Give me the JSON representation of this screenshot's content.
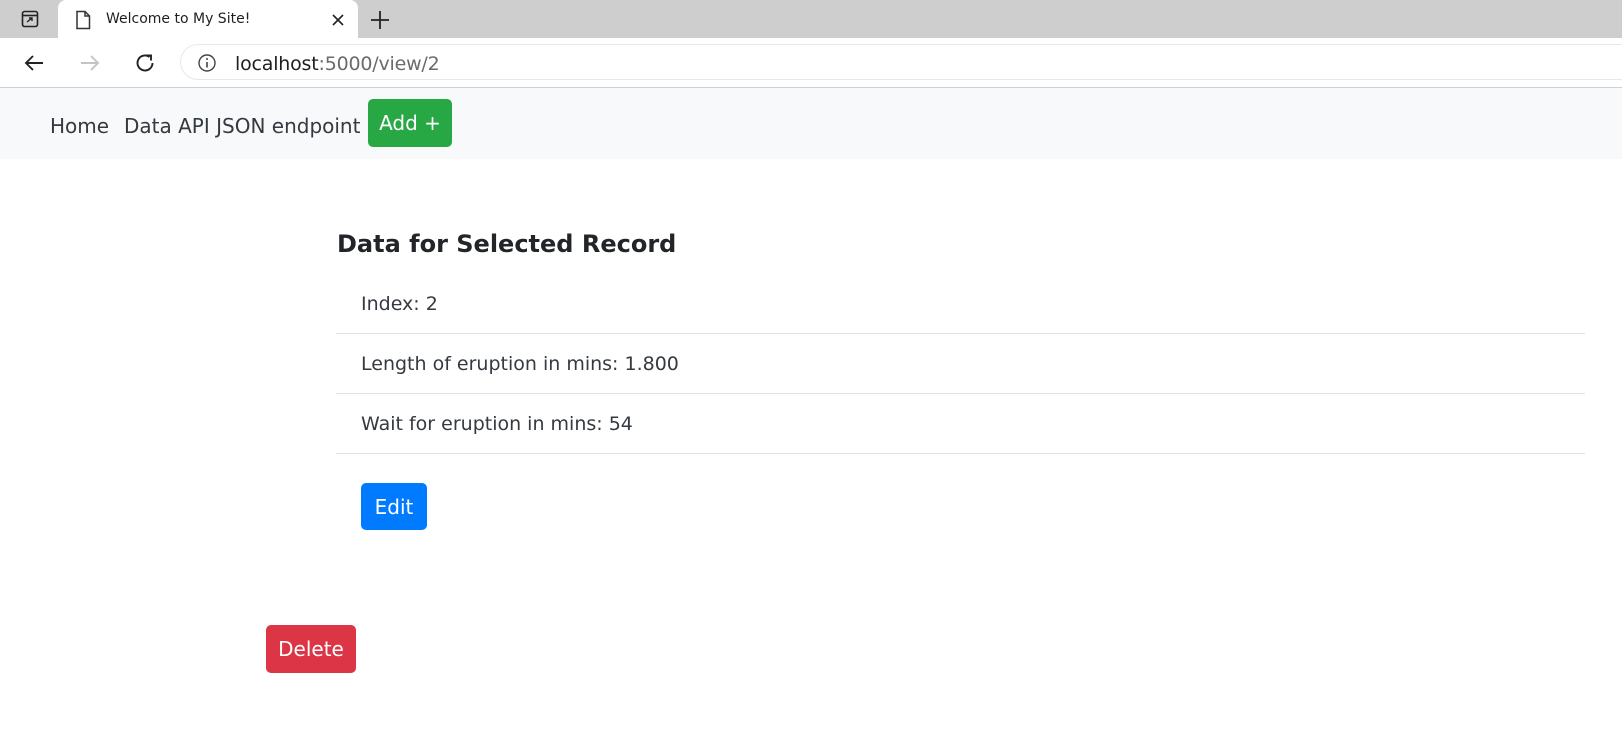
{
  "browser": {
    "tab_title": "Welcome to My Site!",
    "url_host": "localhost",
    "url_path": ":5000/view/2"
  },
  "icons": {
    "tab_actions": "tab-actions-icon",
    "page": "page-icon",
    "close": "close-icon",
    "new_tab": "plus-icon",
    "back": "back-arrow-icon",
    "forward": "forward-arrow-icon",
    "reload": "reload-icon",
    "site_info": "info-icon"
  },
  "nav": {
    "home": "Home",
    "api": "Data API JSON endpoint",
    "add": "Add +"
  },
  "record": {
    "heading": "Data for Selected Record",
    "items": [
      "Index: 2",
      "Length of eruption in mins: 1.800",
      "Wait for eruption in mins: 54"
    ],
    "edit": "Edit",
    "delete": "Delete"
  },
  "colors": {
    "add_button": "#28a745",
    "edit_button": "#007bff",
    "delete_button": "#dc3545",
    "navbar_bg": "#f8f9fa"
  }
}
